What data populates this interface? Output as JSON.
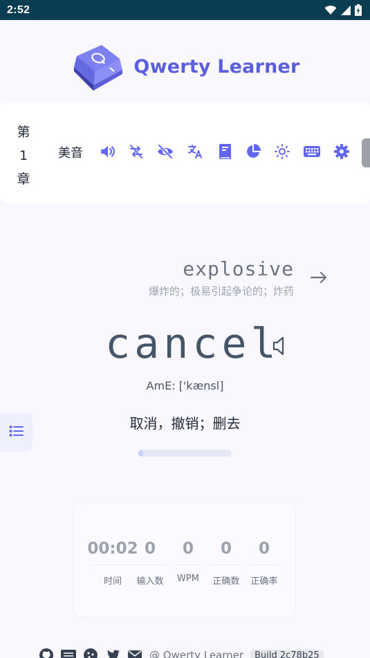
{
  "status_bar": {
    "time": "2:52",
    "icons": [
      "wifi-icon",
      "cell-signal-icon",
      "battery-charging-icon"
    ]
  },
  "header": {
    "app_title": "Qwerty Learner",
    "logo_letter": "Q"
  },
  "toolbar": {
    "chapter": {
      "prefix": "第",
      "number": "1",
      "suffix": "章"
    },
    "accent": "美音",
    "tools": [
      "speaker-icon",
      "shuffle-off-icon",
      "eye-off-icon",
      "translate-icon",
      "book-icon",
      "pie-chart-icon",
      "sun-icon",
      "keyboard-icon",
      "gear-icon"
    ],
    "accent_color": "#6366f1"
  },
  "next_word": {
    "word": "explosive",
    "translation": "爆炸的；极易引起争论的；炸药"
  },
  "current_word": {
    "word": "cancel",
    "phonetic": "AmE: ['kænsl]",
    "translation": "取消，撤销；删去"
  },
  "progress": {
    "fraction": 0.05
  },
  "stats": [
    {
      "value": "00:02",
      "label": "时间"
    },
    {
      "value": "0",
      "label": "输入数"
    },
    {
      "value": "0",
      "label": "WPM"
    },
    {
      "value": "0",
      "label": "正确数"
    },
    {
      "value": "0",
      "label": "正确率"
    }
  ],
  "footer": {
    "icons": [
      "github-icon",
      "wechat-icon",
      "cookie-icon",
      "twitter-icon",
      "mail-icon"
    ],
    "copyright": "@ Qwerty Learner",
    "build": "Build 2c78b25"
  }
}
